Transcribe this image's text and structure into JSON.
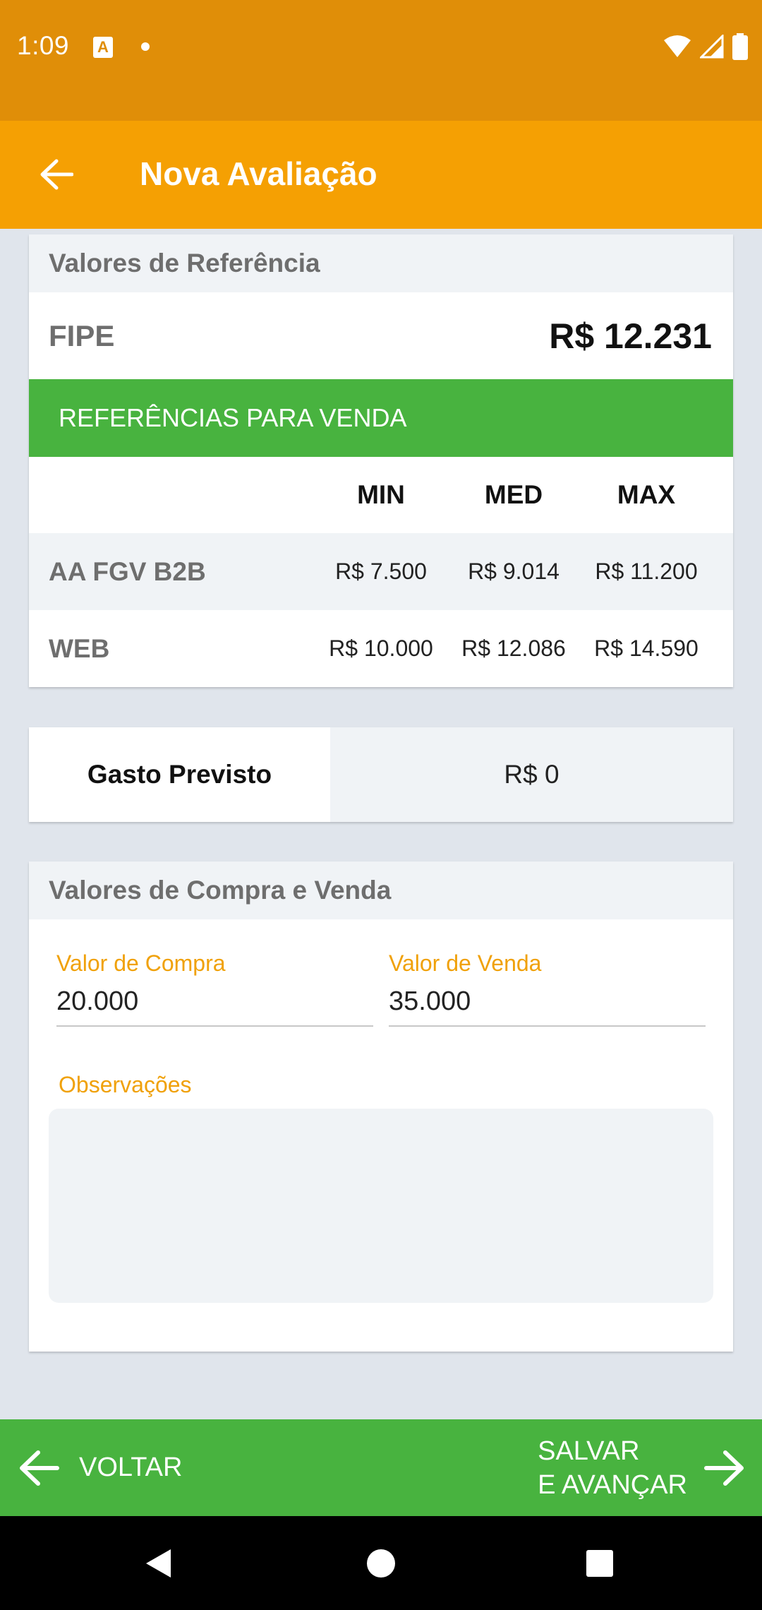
{
  "status_bar": {
    "time": "1:09",
    "notification_glyph": "A"
  },
  "app_bar": {
    "title": "Nova Avaliação",
    "back_icon": "arrow-left-icon"
  },
  "reference_values": {
    "header": "Valores de Referência",
    "fipe_label": "FIPE",
    "fipe_value": "R$  12.231",
    "sale_references_title": "REFERÊNCIAS PARA VENDA",
    "columns": [
      "MIN",
      "MED",
      "MAX"
    ],
    "rows": [
      {
        "label": "AA FGV B2B",
        "values": [
          "R$  7.500",
          "R$  9.014",
          "R$  11.200"
        ]
      },
      {
        "label": "WEB",
        "values": [
          "R$  10.000",
          "R$  12.086",
          "R$  14.590"
        ]
      }
    ]
  },
  "expected_expense": {
    "label": "Gasto Previsto",
    "value": "R$  0"
  },
  "buy_sell": {
    "header": "Valores de Compra e Venda",
    "purchase_label": "Valor de Compra",
    "purchase_value": "20.000",
    "sale_label": "Valor de Venda",
    "sale_value": "35.000",
    "notes_label": "Observações",
    "notes_value": ""
  },
  "bottom_bar": {
    "back_label": "VOLTAR",
    "next_label_line1": "SALVAR",
    "next_label_line2": "E AVANÇAR"
  },
  "colors": {
    "status_bar": "#e08e08",
    "app_bar": "#f5a003",
    "accent_green": "#48b33f",
    "label_orange": "#f0a10a",
    "background": "#e0e5ec"
  }
}
